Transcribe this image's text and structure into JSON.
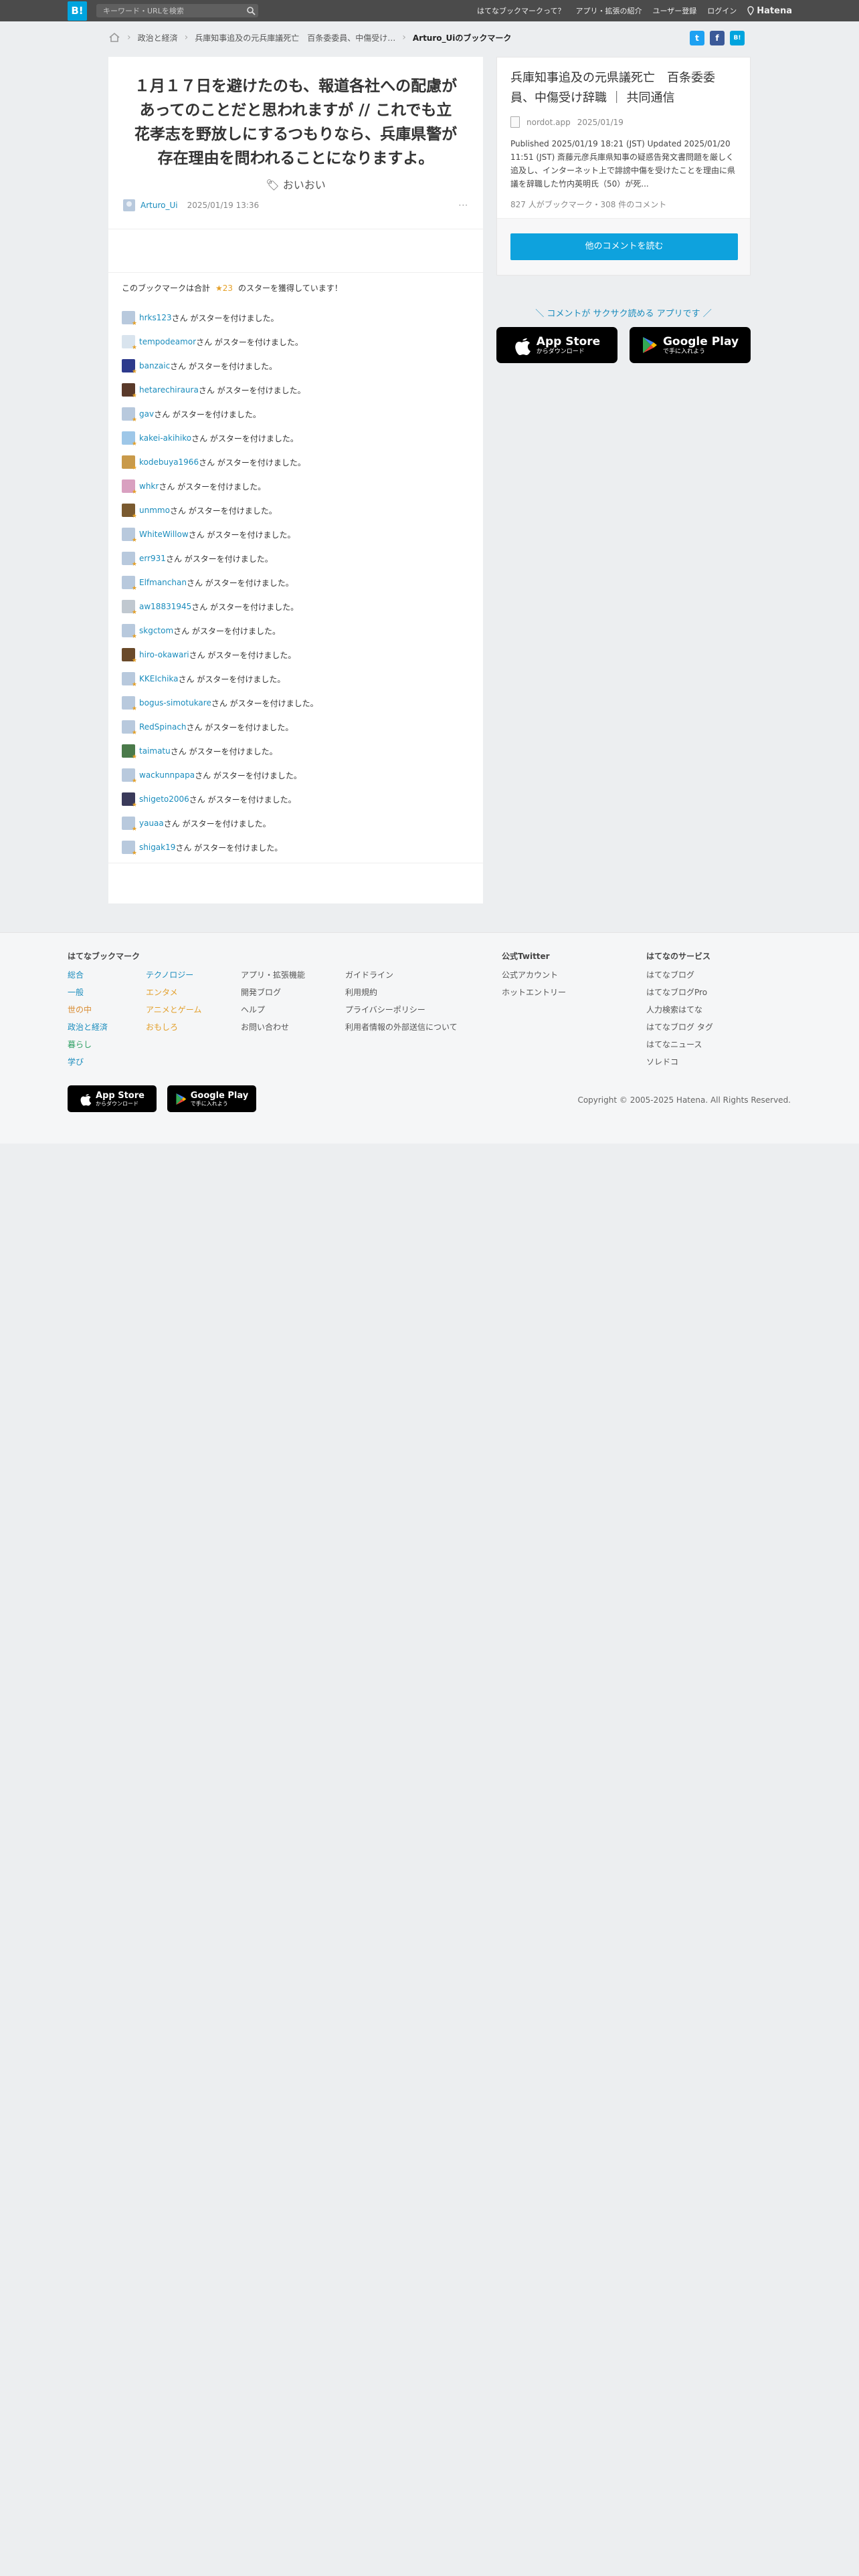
{
  "topbar": {
    "logo": "B!",
    "search_placeholder": "キーワード・URLを検索",
    "nav": [
      "はてなブックマークって？",
      "アプリ・拡張の紹介",
      "ユーザー登録",
      "ログイン"
    ],
    "brand": "Hatena"
  },
  "breadcrumb": [
    "政治と経済",
    "兵庫知事追及の元兵庫議死亡　百条委委員、中傷受け…",
    "Arturo_Uiのブックマーク"
  ],
  "share": {
    "twitter": "t",
    "facebook": "f",
    "hatena": "B!"
  },
  "bookmark": {
    "comment": "１月１７日を避けたのも、報道各社への配慮があってのことだと思われますが // これでも立花孝志を野放しにするつもりなら、兵庫県警が存在理由を問われることになりますよ。",
    "tag": "おいおい",
    "user": "Arturo_Ui",
    "date": "2025/01/19 13:36",
    "more": "···"
  },
  "stars": {
    "prefix": "このブックマークは合計",
    "count": "★23",
    "suffix": "のスターを獲得しています！",
    "action_text": "さん がスターを付けました。",
    "users": [
      "hrks123",
      "tempodeamor",
      "banzaic",
      "hetarechiraura",
      "gav",
      "kakei-akihiko",
      "kodebuya1966",
      "whkr",
      "unmmo",
      "WhiteWillow",
      "err931",
      "Elfmanchan",
      "aw18831945",
      "skgctom",
      "hiro-okawari",
      "KKEIchika",
      "bogus-simotukare",
      "RedSpinach",
      "taimatu",
      "wackunnpapa",
      "shigeto2006",
      "yauaa",
      "shigak19"
    ]
  },
  "entry": {
    "title": "兵庫知事追及の元県議死亡　百条委委員、中傷受け辞職 ｜ 共同通信",
    "source": "nordot.app",
    "date": "2025/01/19",
    "description": "Published 2025/01/19 18:21 (JST) Updated 2025/01/20 11:51 (JST) 斎藤元彦兵庫県知事の疑惑告発文書問題を厳しく追及し、インターネット上で誹謗中傷を受けたことを理由に県議を辞職した竹内英明氏（50）が死...",
    "count": "827 人がブックマーク・308 件のコメント",
    "button": "他のコメントを読む"
  },
  "app_promo": {
    "text": "＼ コメントが サクサク読める アプリです ／",
    "appstore_line1": "App Store",
    "appstore_line2": "からダウンロード",
    "googleplay_line1": "Google Play",
    "googleplay_line2": "で手に入れよう"
  },
  "footer": {
    "heading_main": "はてなブックマーク",
    "categories_col1": [
      "総合",
      "一般",
      "世の中",
      "政治と経済",
      "暮らし",
      "学び"
    ],
    "categories_col2": [
      "テクノロジー",
      "エンタメ",
      "アニメとゲーム",
      "おもしろ"
    ],
    "links_col3": [
      "アプリ・拡張機能",
      "開発ブログ",
      "ヘルプ",
      "お問い合わせ"
    ],
    "links_col4": [
      "ガイドライン",
      "利用規約",
      "プライバシーポリシー",
      "利用者情報の外部送信について"
    ],
    "heading_twitter": "公式Twitter",
    "twitter_links": [
      "公式アカウント",
      "ホットエントリー"
    ],
    "heading_services": "はてなのサービス",
    "services": [
      "はてなブログ",
      "はてなブログPro",
      "人力検索はてな",
      "はてなブログ タグ",
      "はてなニュース",
      "ソレドコ"
    ],
    "copyright": "Copyright © 2005-2025 Hatena. All Rights Reserved.",
    "appstore_line1": "App Store",
    "appstore_line2": "からダウンロード",
    "googleplay_line1": "Google Play",
    "googleplay_line2": "で手に入れよう"
  },
  "colors": {
    "accent": "#00a4de",
    "link": "#1a8cbd",
    "star": "#e5a12a"
  }
}
